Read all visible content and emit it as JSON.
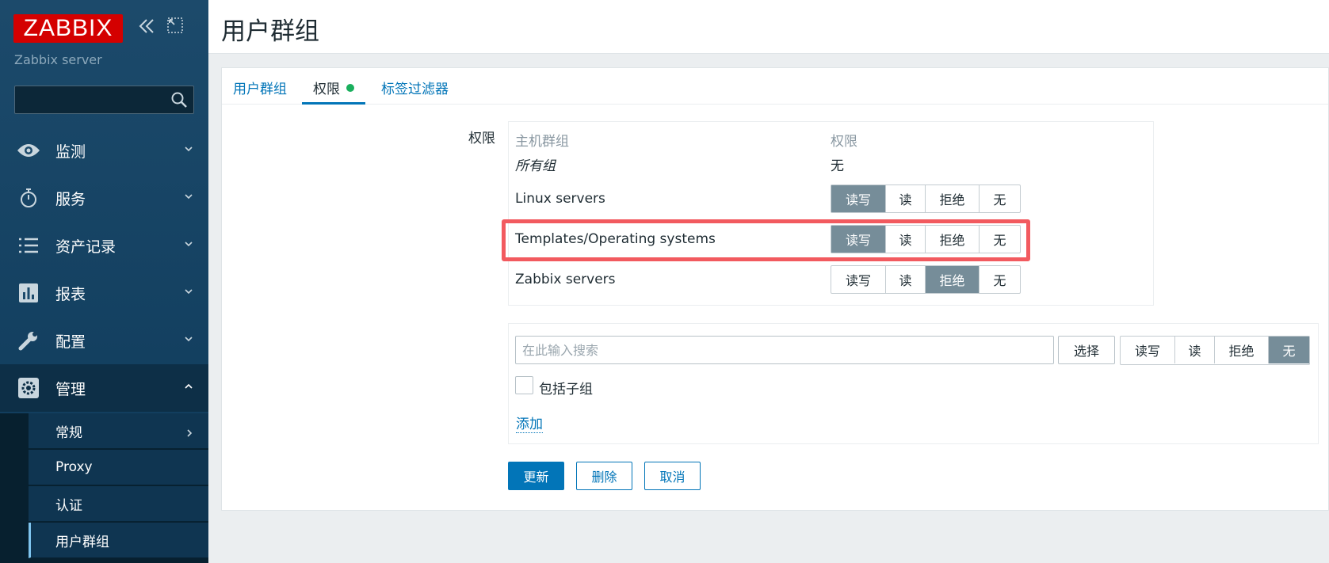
{
  "sidebar": {
    "logo": "ZABBIX",
    "server_name": "Zabbix server",
    "search": {
      "value": "",
      "placeholder": ""
    },
    "menu": [
      {
        "label": "监测",
        "icon": "eye-icon"
      },
      {
        "label": "服务",
        "icon": "stopwatch-icon"
      },
      {
        "label": "资产记录",
        "icon": "list-icon"
      },
      {
        "label": "报表",
        "icon": "bar-chart-icon"
      },
      {
        "label": "配置",
        "icon": "wrench-icon"
      },
      {
        "label": "管理",
        "icon": "gear-icon"
      }
    ],
    "submenu": [
      "常规",
      "Proxy",
      "认证",
      "用户群组"
    ]
  },
  "header": {
    "title": "用户群组"
  },
  "tabs": [
    {
      "label": "用户群组"
    },
    {
      "label": "权限"
    },
    {
      "label": "标签过滤器"
    }
  ],
  "permissions": {
    "label": "权限",
    "col_hostgroup": "主机群组",
    "col_permission": "权限",
    "all_groups": {
      "name": "所有组",
      "value": "无"
    },
    "options": [
      "读写",
      "读",
      "拒绝",
      "无"
    ],
    "rows": [
      {
        "name": "Linux servers",
        "selected": "读写"
      },
      {
        "name": "Templates/Operating systems",
        "selected": "读写"
      },
      {
        "name": "Zabbix servers",
        "selected": "拒绝"
      }
    ]
  },
  "add": {
    "search_placeholder": "在此输入搜索",
    "select_label": "选择",
    "selected": "无",
    "include_subgroups": "包括子组",
    "add_link": "添加"
  },
  "buttons": {
    "update": "更新",
    "delete": "删除",
    "cancel": "取消"
  },
  "colors": {
    "sidebar": "#0e3a5a",
    "accent": "#0275b8",
    "selected": "#768d99",
    "highlight": "#f25a5f",
    "logo": "#d40000"
  }
}
